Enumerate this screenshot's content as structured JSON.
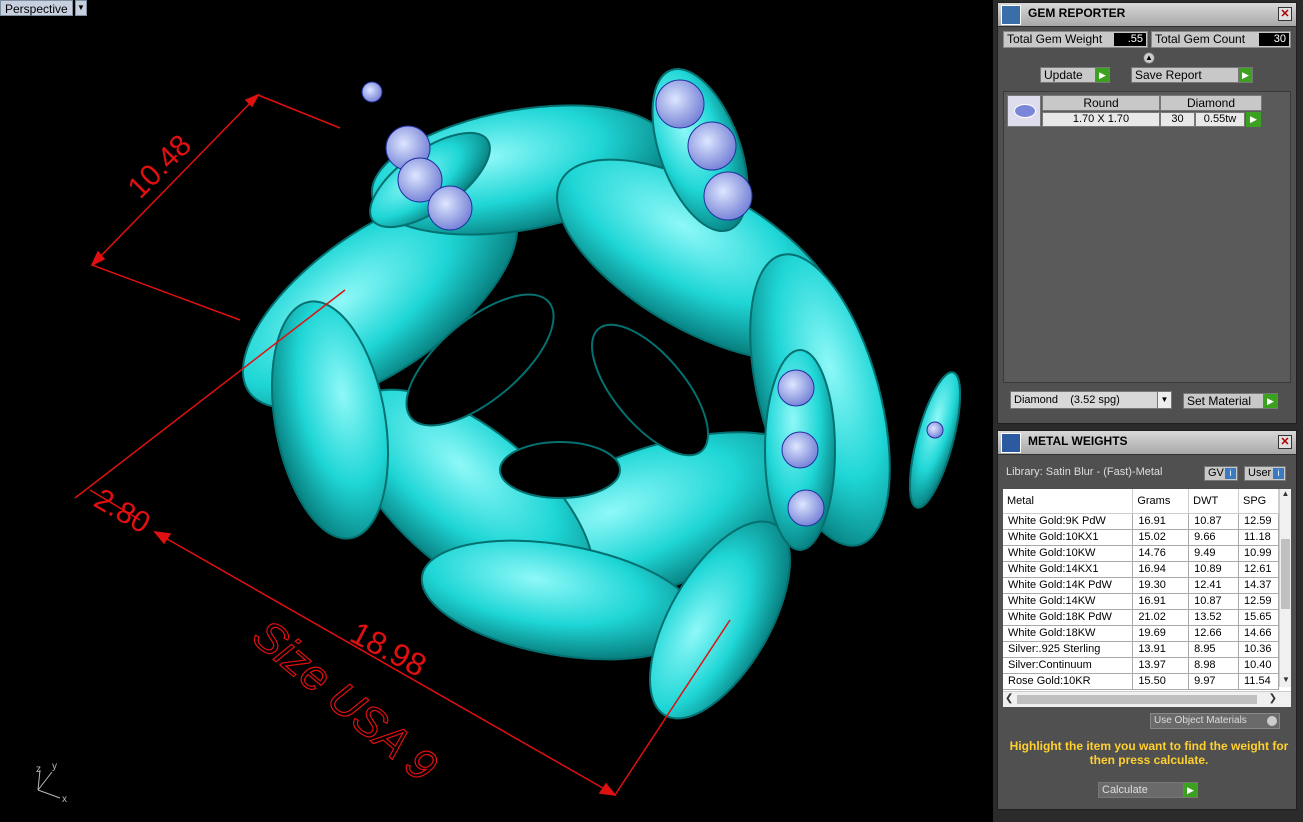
{
  "viewport": {
    "label": "Perspective",
    "dim_top": "10.48",
    "dim_mid": "2.80",
    "dim_bottom": "18.98",
    "size_text": "Size USA 9",
    "axis_z": "z",
    "axis_y": "y",
    "axis_x": "x"
  },
  "gem_reporter": {
    "title": "GEM REPORTER",
    "total_weight_label": "Total Gem Weight",
    "total_weight_value": ".55",
    "total_count_label": "Total Gem Count",
    "total_count_value": "30",
    "update_label": "Update",
    "save_label": "Save Report",
    "gem": {
      "shape": "Round",
      "type": "Diamond",
      "size": "1.70 X 1.70",
      "count": "30",
      "weight": "0.55tw"
    },
    "material_select": "Diamond    (3.52 spg)",
    "set_material_label": "Set Material"
  },
  "metal_weights": {
    "title": "METAL WEIGHTS",
    "library": "Library: Satin Blur - (Fast)-Metal",
    "gv_label": "GV",
    "user_label": "User",
    "columns": [
      "Metal",
      "Grams",
      "DWT",
      "SPG"
    ],
    "rows": [
      [
        "White Gold:9K PdW",
        "16.91",
        "10.87",
        "12.59"
      ],
      [
        "White Gold:10KX1",
        "15.02",
        "9.66",
        "11.18"
      ],
      [
        "White Gold:10KW",
        "14.76",
        "9.49",
        "10.99"
      ],
      [
        "White Gold:14KX1",
        "16.94",
        "10.89",
        "12.61"
      ],
      [
        "White Gold:14K PdW",
        "19.30",
        "12.41",
        "14.37"
      ],
      [
        "White Gold:14KW",
        "16.91",
        "10.87",
        "12.59"
      ],
      [
        "White Gold:18K PdW",
        "21.02",
        "13.52",
        "15.65"
      ],
      [
        "White Gold:18KW",
        "19.69",
        "12.66",
        "14.66"
      ],
      [
        "Silver:.925 Sterling",
        "13.91",
        "8.95",
        "10.36"
      ],
      [
        "Silver:Continuum",
        "13.97",
        "8.98",
        "10.40"
      ],
      [
        "Rose Gold:10KR",
        "15.50",
        "9.97",
        "11.54"
      ]
    ],
    "use_object_label": "Use Object Materials",
    "note": "Highlight the item you want to find the weight for then press calculate.",
    "calculate_label": "Calculate"
  }
}
